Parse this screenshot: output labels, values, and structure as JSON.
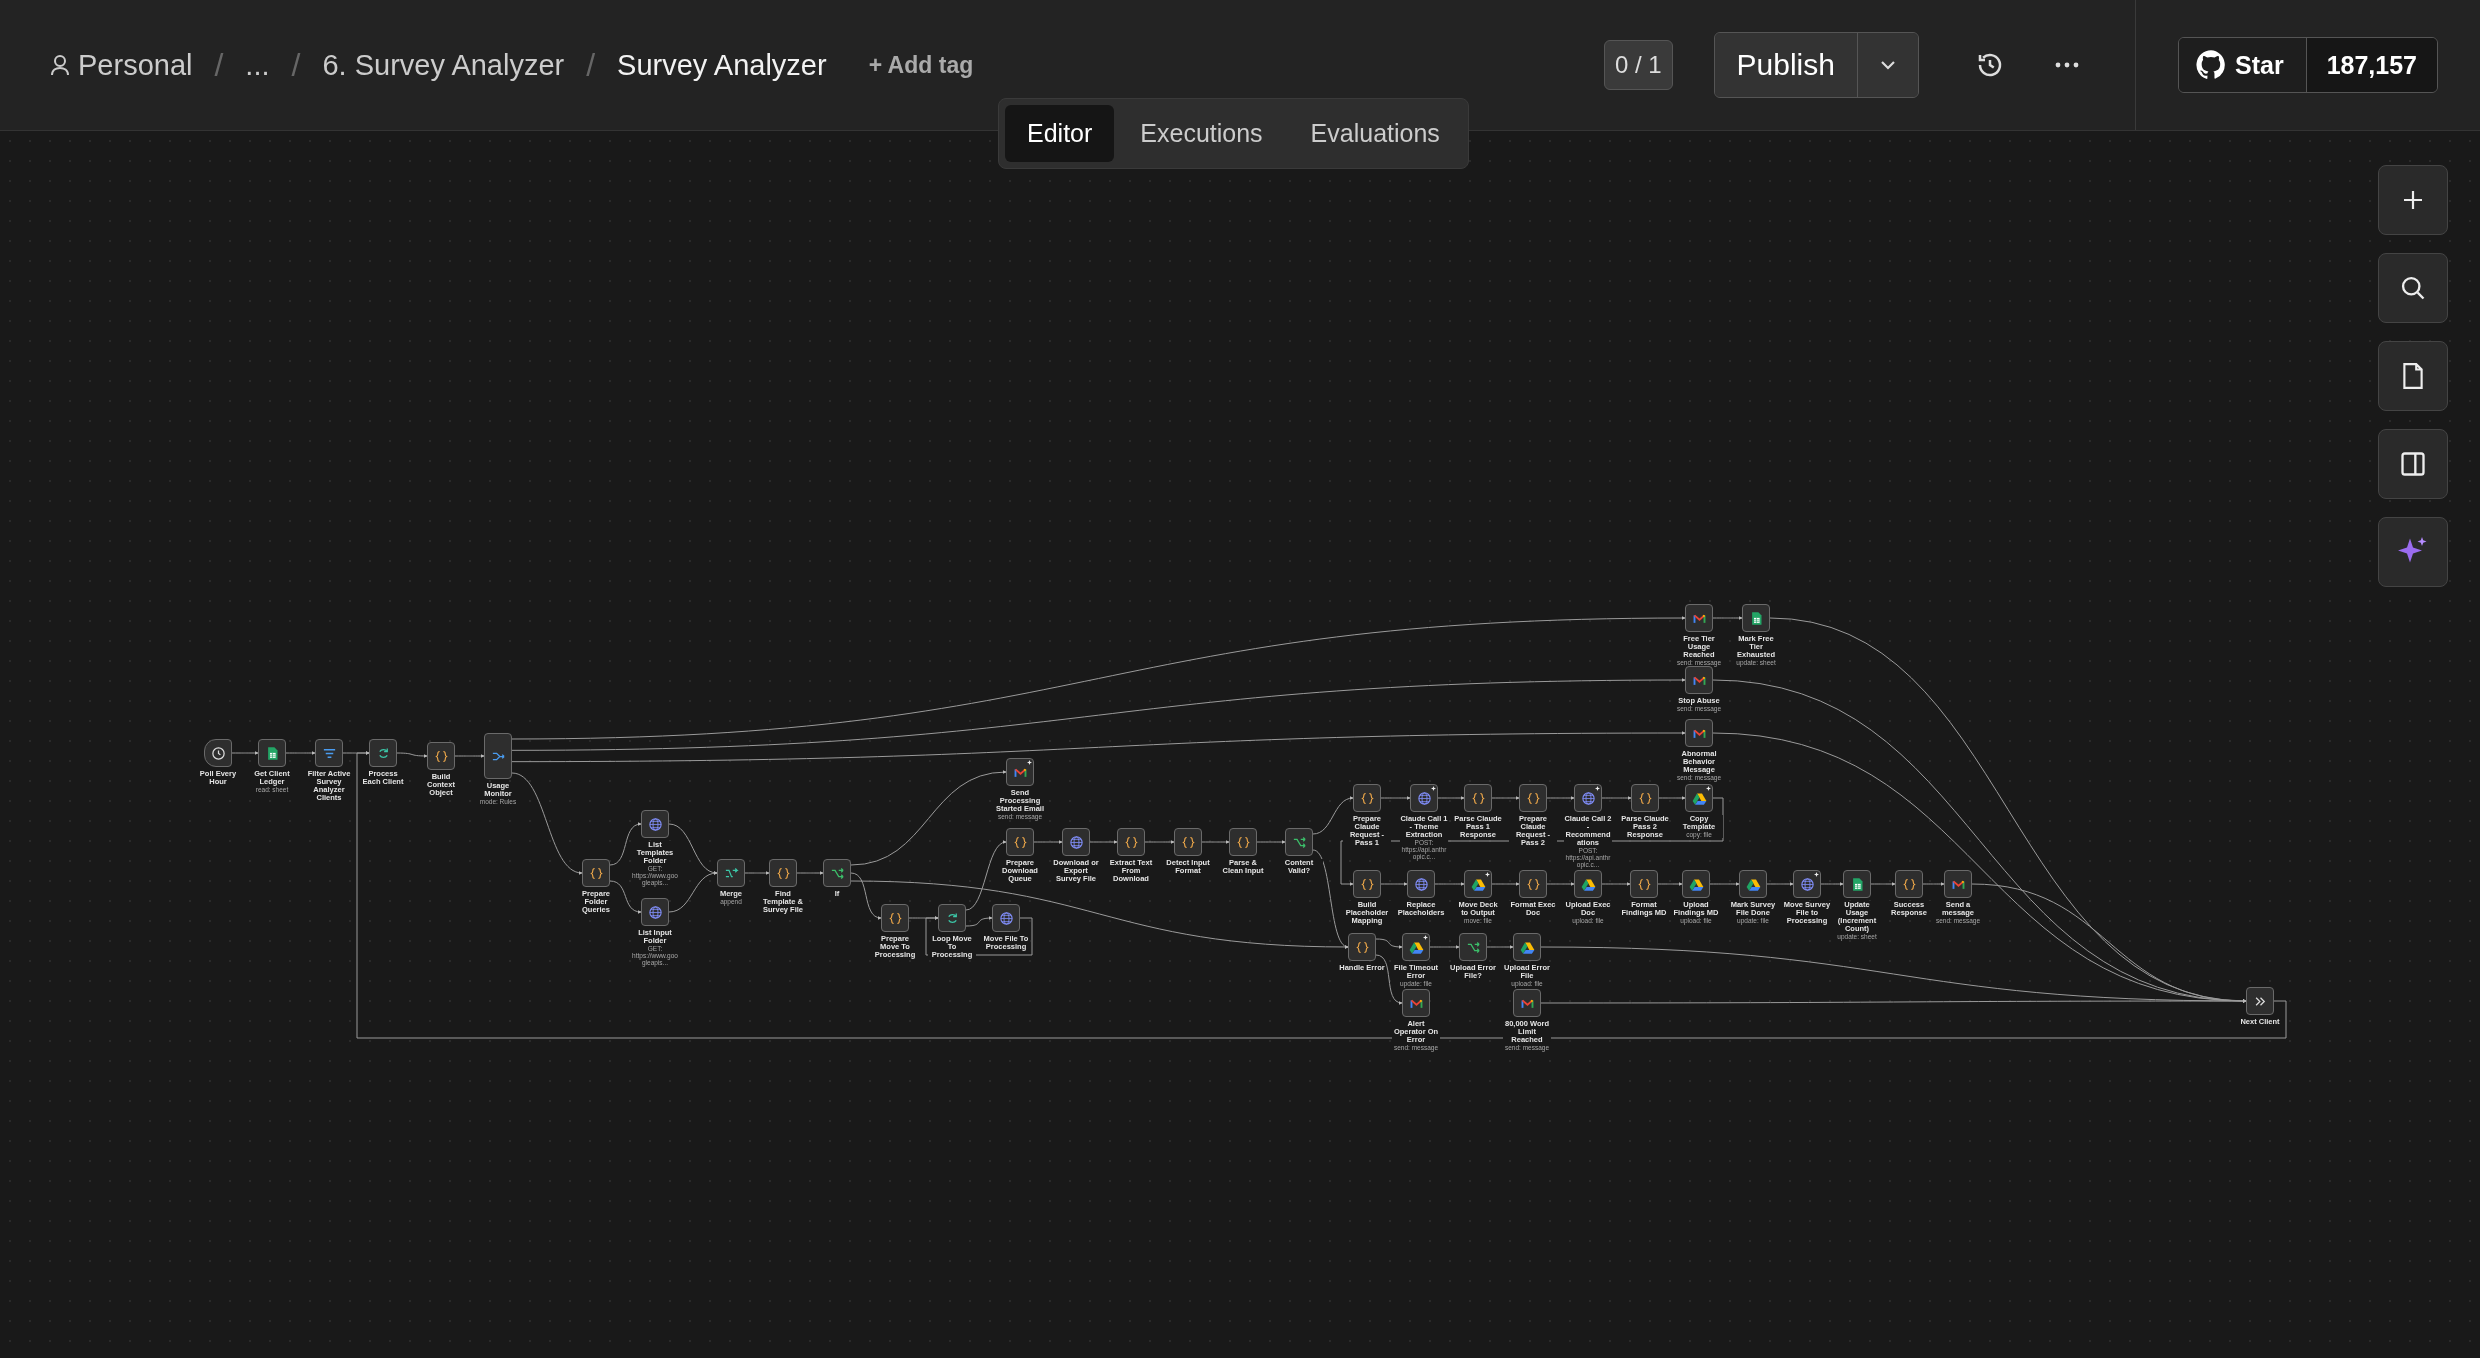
{
  "breadcrumb": {
    "owner": "Personal",
    "ellipsis": "...",
    "folder": "6. Survey Analyzer",
    "workflow": "Survey Analyzer",
    "separators": [
      "/",
      "/",
      "/"
    ]
  },
  "add_tag": "+ Add tag",
  "counter": "0 / 1",
  "publish": "Publish",
  "tabs": [
    {
      "label": "Editor",
      "selected": true
    },
    {
      "label": "Executions",
      "selected": false
    },
    {
      "label": "Evaluations",
      "selected": false
    }
  ],
  "github": {
    "label": "Star",
    "count": "187,157"
  },
  "nodes": [
    {
      "label": "Poll Every Hour",
      "kind": "trigger",
      "marked": false
    },
    {
      "label": "Get Client Ledger",
      "subtitle": "read: sheet",
      "kind": "sheets",
      "marked": false
    },
    {
      "label": "Filter Active Survey Analyzer Clients",
      "kind": "filter",
      "marked": false
    },
    {
      "label": "Process Each Client",
      "kind": "loop",
      "marked": false
    },
    {
      "label": "Build Context Object",
      "kind": "code",
      "marked": false
    },
    {
      "label": "Usage Monitor",
      "subtitle": "mode: Rules",
      "kind": "switch",
      "marked": false
    },
    {
      "label": "Prepare Folder Queries",
      "kind": "code",
      "marked": false
    },
    {
      "label": "List Templates Folder",
      "subtitle": "GET: https://www.googleapis...",
      "kind": "http",
      "marked": false
    },
    {
      "label": "List Input Folder",
      "subtitle": "GET: https://www.googleapis...",
      "kind": "http",
      "marked": false
    },
    {
      "label": "Merge",
      "subtitle": "append",
      "kind": "merge",
      "marked": false
    },
    {
      "label": "Find Template & Survey File",
      "kind": "code",
      "marked": false
    },
    {
      "label": "If",
      "kind": "if",
      "marked": false
    },
    {
      "label": "Send Processing Started Email",
      "subtitle": "send: message",
      "kind": "gmail",
      "marked": true
    },
    {
      "label": "Prepare Download Queue",
      "kind": "code",
      "marked": false
    },
    {
      "label": "Download or Export Survey File",
      "kind": "http",
      "marked": false
    },
    {
      "label": "Extract Text From Download",
      "kind": "code",
      "marked": false
    },
    {
      "label": "Detect Input Format",
      "kind": "code",
      "marked": false
    },
    {
      "label": "Parse & Clean Input",
      "kind": "code",
      "marked": false
    },
    {
      "label": "Content Valid?",
      "kind": "if",
      "marked": false
    },
    {
      "label": "Prepare Move To Processing",
      "kind": "code",
      "marked": false
    },
    {
      "label": "Loop Move To Processing",
      "kind": "loop",
      "marked": false
    },
    {
      "label": "Move File To Processing",
      "kind": "http",
      "marked": false
    },
    {
      "label": "Prepare Claude Request - Pass 1",
      "kind": "code",
      "marked": false
    },
    {
      "label": "Claude Call 1 - Theme Extraction",
      "subtitle": "POST: https://api.anthropic.c...",
      "kind": "http",
      "marked": true
    },
    {
      "label": "Parse Claude Pass 1 Response",
      "kind": "code",
      "marked": false
    },
    {
      "label": "Prepare Claude Request - Pass 2",
      "kind": "code",
      "marked": false
    },
    {
      "label": "Claude Call 2 - Recommendations",
      "subtitle": "POST: https://api.anthropic.c...",
      "kind": "http",
      "marked": true
    },
    {
      "label": "Parse Claude Pass 2 Response",
      "kind": "code",
      "marked": false
    },
    {
      "label": "Copy Template",
      "subtitle": "copy: file",
      "kind": "drive",
      "marked": true
    },
    {
      "label": "Build Placeholder Mapping",
      "kind": "code",
      "marked": false
    },
    {
      "label": "Replace Placeholders",
      "kind": "http",
      "marked": false
    },
    {
      "label": "Move Deck to Output",
      "subtitle": "move: file",
      "kind": "drive",
      "marked": true
    },
    {
      "label": "Format Exec Doc",
      "kind": "code",
      "marked": false
    },
    {
      "label": "Upload Exec Doc",
      "subtitle": "upload: file",
      "kind": "drive",
      "marked": false
    },
    {
      "label": "Format Findings MD",
      "kind": "code",
      "marked": false
    },
    {
      "label": "Upload Findings MD",
      "subtitle": "upload: file",
      "kind": "drive",
      "marked": false
    },
    {
      "label": "Mark Survey File Done",
      "subtitle": "update: file",
      "kind": "drive",
      "marked": false
    },
    {
      "label": "Move Survey File to Processing",
      "kind": "http",
      "marked": true
    },
    {
      "label": "Update Usage (Increment Count)",
      "subtitle": "update: sheet",
      "kind": "sheets",
      "marked": false
    },
    {
      "label": "Success Response",
      "kind": "code",
      "marked": false
    },
    {
      "label": "Send a message",
      "subtitle": "send: message",
      "kind": "gmail",
      "marked": false
    },
    {
      "label": "Handle Error",
      "kind": "code",
      "marked": false
    },
    {
      "label": "File Timeout Error",
      "subtitle": "update: file",
      "kind": "drive",
      "marked": true
    },
    {
      "label": "Upload Error File?",
      "kind": "if",
      "marked": false
    },
    {
      "label": "Upload Error File",
      "subtitle": "upload: file",
      "kind": "drive",
      "marked": false
    },
    {
      "label": "Alert Operator On Error",
      "subtitle": "send: message",
      "kind": "gmail",
      "marked": false
    },
    {
      "label": "80,000 Word Limit Reached",
      "subtitle": "send: message",
      "kind": "gmail",
      "marked": false
    },
    {
      "label": "Free Tier Usage Reached",
      "subtitle": "send: message",
      "kind": "gmail",
      "marked": false
    },
    {
      "label": "Mark Free Tier Exhausted",
      "subtitle": "update: sheet",
      "kind": "sheets",
      "marked": false
    },
    {
      "label": "Stop Abuse",
      "subtitle": "send: message",
      "kind": "gmail",
      "marked": false
    },
    {
      "label": "Abnormal Behavior Message",
      "subtitle": "send: message",
      "kind": "gmail",
      "marked": false
    },
    {
      "label": "Next Client",
      "kind": "next",
      "marked": false
    }
  ]
}
